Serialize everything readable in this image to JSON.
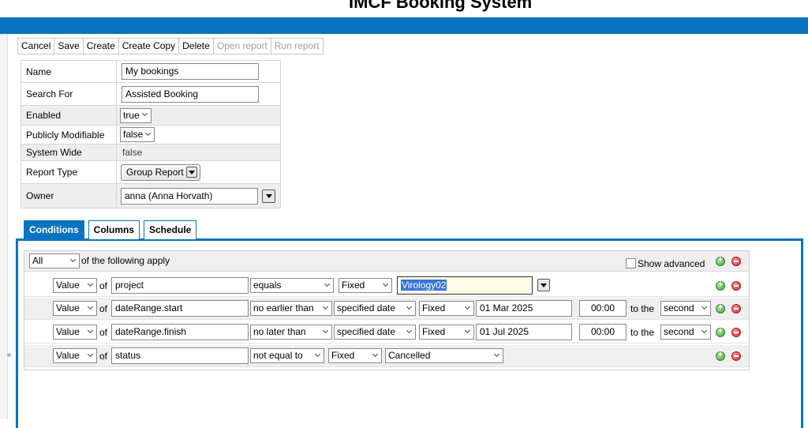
{
  "app": {
    "title": "IMCF Booking System"
  },
  "toolbar": {
    "cancel": "Cancel",
    "save": "Save",
    "create": "Create",
    "create_copy": "Create Copy",
    "delete": "Delete",
    "open_report": "Open report",
    "run_report": "Run report"
  },
  "properties": {
    "name_label": "Name",
    "name_value": "My bookings",
    "search_label": "Search For",
    "search_value": "Assisted Booking",
    "enabled_label": "Enabled",
    "enabled_value": "true",
    "public_label": "Publicly Modifiable",
    "public_value": "false",
    "system_label": "System Wide",
    "system_value": "false",
    "type_label": "Report Type",
    "type_value": "Group Report",
    "owner_label": "Owner",
    "owner_value": "anna (Anna Horvath)"
  },
  "tabs": {
    "conditions": "Conditions",
    "columns": "Columns",
    "schedule": "Schedule"
  },
  "conditions": {
    "match": "All",
    "match_suffix": "of the following apply",
    "show_advanced": "Show advanced",
    "of": "of",
    "to_the": "to the",
    "rows": [
      {
        "kind": "Value",
        "field": "project",
        "op": "equals",
        "mode": "Fixed",
        "value": "Virology02"
      },
      {
        "kind": "Value",
        "field": "dateRange.start",
        "op": "no earlier than",
        "spec": "specified date",
        "mode": "Fixed",
        "date": "01 Mar 2025",
        "time": "00:00",
        "unit": "second"
      },
      {
        "kind": "Value",
        "field": "dateRange.finish",
        "op": "no later than",
        "spec": "specified date",
        "mode": "Fixed",
        "date": "01 Jul 2025",
        "time": "00:00",
        "unit": "second"
      },
      {
        "kind": "Value",
        "field": "status",
        "op": "not equal to",
        "mode": "Fixed",
        "value": "Cancelled"
      }
    ]
  }
}
